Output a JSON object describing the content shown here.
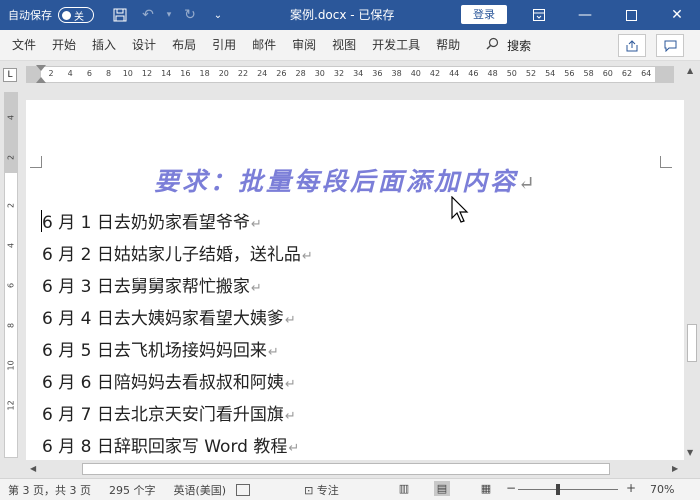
{
  "titlebar": {
    "autosave_label": "自动保存",
    "autosave_state": "关",
    "doc_title": "案例.docx - 已保存",
    "login_label": "登录"
  },
  "menu": {
    "items": [
      "文件",
      "开始",
      "插入",
      "设计",
      "布局",
      "引用",
      "邮件",
      "审阅",
      "视图",
      "开发工具",
      "帮助"
    ],
    "search_label": "搜索"
  },
  "ruler": {
    "corner": "L",
    "ticks": [
      "2",
      "4",
      "6",
      "8",
      "10",
      "12",
      "14",
      "16",
      "18",
      "20",
      "22",
      "24",
      "26",
      "28",
      "30",
      "32",
      "34",
      "36",
      "38",
      "40",
      "42",
      "44",
      "46",
      "48",
      "50",
      "52",
      "54",
      "56",
      "58",
      "60",
      "62",
      "64"
    ],
    "vticks": [
      "4",
      "2",
      "2",
      "4",
      "6",
      "8",
      "10",
      "12"
    ]
  },
  "document": {
    "heading": "要求：批量每段后面添加内容",
    "paragraphs": [
      "6 月 1 日去奶奶家看望爷爷",
      "6 月 2 日姑姑家儿子结婚，送礼品",
      "6 月 3 日去舅舅家帮忙搬家",
      "6 月 4 日去大姨妈家看望大姨爹",
      "6 月 5 日去飞机场接妈妈回来",
      "6 月 6 日陪妈妈去看叔叔和阿姨",
      "6 月 7 日去北京天安门看升国旗",
      "6 月 8 日辞职回家写 Word 教程"
    ],
    "para_mark": "↵"
  },
  "statusbar": {
    "page_info": "第 3 页，共 3 页",
    "word_count": "295 个字",
    "language": "英语(美国)",
    "focus_label": "专注",
    "zoom_minus": "−",
    "zoom_plus": "+",
    "zoom": "70%"
  },
  "colors": {
    "titlebar": "#2b579a",
    "heading": "#7b7ed8"
  }
}
